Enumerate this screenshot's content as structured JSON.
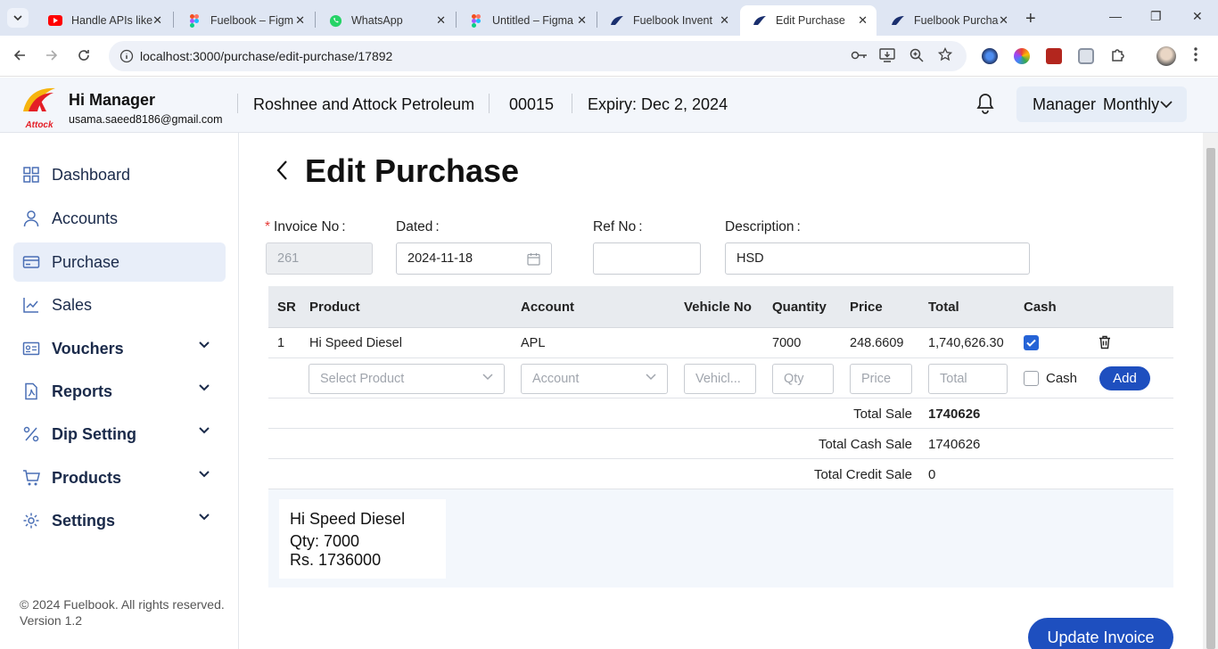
{
  "browser": {
    "tabs": [
      {
        "title": "Handle APIs like",
        "icon": "youtube-icon"
      },
      {
        "title": "Fuelbook – Figm",
        "icon": "figma-icon"
      },
      {
        "title": "WhatsApp",
        "icon": "whatsapp-icon"
      },
      {
        "title": "Untitled – Figma",
        "icon": "figma-icon"
      },
      {
        "title": "Fuelbook Invent",
        "icon": "fuelbook-icon"
      },
      {
        "title": "Edit Purchase",
        "icon": "fuelbook-icon",
        "active": true
      },
      {
        "title": "Fuelbook Purcha",
        "icon": "fuelbook-icon"
      }
    ],
    "url": "localhost:3000/purchase/edit-purchase/17892"
  },
  "header": {
    "manager_title": "Hi Manager",
    "email": "usama.saeed8186@gmail.com",
    "logo_text": "Attock",
    "company": "Roshnee and Attock Petroleum",
    "code": "00015",
    "expiry": "Expiry: Dec 2, 2024",
    "plan_role": "Manager",
    "plan_type": "Monthly"
  },
  "sidebar": {
    "items": [
      {
        "label": "Dashboard",
        "icon": "dashboard-icon"
      },
      {
        "label": "Accounts",
        "icon": "user-icon"
      },
      {
        "label": "Purchase",
        "icon": "card-icon",
        "active": true
      },
      {
        "label": "Sales",
        "icon": "chart-line-icon"
      },
      {
        "label": "Vouchers",
        "icon": "voucher-icon",
        "expandable": true
      },
      {
        "label": "Reports",
        "icon": "report-icon",
        "expandable": true
      },
      {
        "label": "Dip Setting",
        "icon": "percent-icon",
        "expandable": true
      },
      {
        "label": "Products",
        "icon": "cart-icon",
        "expandable": true
      },
      {
        "label": "Settings",
        "icon": "gear-icon",
        "expandable": true
      }
    ],
    "footer_copyright": "© 2024 Fuelbook. All rights reserved.",
    "footer_version": "Version 1.2"
  },
  "page": {
    "title": "Edit Purchase",
    "fields": {
      "invoice_label": "Invoice No",
      "invoice_value": "261",
      "dated_label": "Dated",
      "dated_value": "2024-11-18",
      "ref_label": "Ref No",
      "ref_value": "",
      "description_label": "Description",
      "description_value": "HSD"
    },
    "table": {
      "headers": [
        "SR",
        "Product",
        "Account",
        "Vehicle No",
        "Quantity",
        "Price",
        "Total",
        "Cash"
      ],
      "rows": [
        {
          "sr": "1",
          "product": "Hi Speed Diesel",
          "account": "APL",
          "vehicle": "",
          "quantity": "7000",
          "price": "248.6609",
          "total": "1,740,626.30",
          "cash": true
        }
      ],
      "new_row": {
        "product_placeholder": "Select Product",
        "account_placeholder": "Account",
        "vehicle_placeholder": "Vehicl...",
        "qty_placeholder": "Qty",
        "price_placeholder": "Price",
        "total_placeholder": "Total",
        "cash_label": "Cash",
        "add_label": "Add"
      }
    },
    "totals": {
      "total_sale_label": "Total Sale",
      "total_sale_value": "1740626",
      "total_cash_label": "Total Cash Sale",
      "total_cash_value": "1740626",
      "total_credit_label": "Total Credit Sale",
      "total_credit_value": "0"
    },
    "summary_card": {
      "product": "Hi Speed Diesel",
      "qty": "Qty: 7000",
      "amount": "Rs. 1736000"
    },
    "update_button": "Update Invoice"
  },
  "colors": {
    "primary": "#1e4fbf",
    "checkbox": "#2563d6",
    "sidebar_active": "#e8eef9",
    "required": "#e53935"
  }
}
